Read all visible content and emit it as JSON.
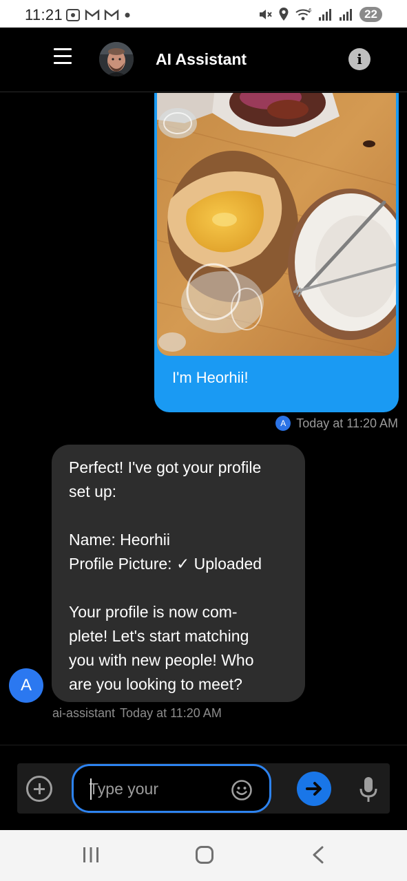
{
  "status_bar": {
    "time": "11:21",
    "battery": "22",
    "left_icons": [
      "screenshot-icon",
      "gmail-icon",
      "gmail-icon",
      "dot-icon"
    ],
    "right_icons": [
      "mute-icon",
      "location-icon",
      "wifi-icon",
      "signal-icon",
      "signal-icon",
      "battery-icon"
    ]
  },
  "header": {
    "title": "AI Assistant",
    "menu_icon": "hamburger-menu-icon",
    "info_icon": "info-icon",
    "info_glyph": "i"
  },
  "messages": {
    "user": {
      "text": "I'm Heorhii!",
      "avatar_letter": "A",
      "timestamp": "Today at 11:20 AM",
      "bubble_color": "#1a9af3"
    },
    "assistant": {
      "lines_1": [
        "Perfect! I've got your profile",
        "set up:"
      ],
      "lines_2": [
        "Name: Heorhii",
        "Profile Picture: ✓ Uploaded"
      ],
      "lines_3": [
        "Your profile is now com-",
        "plete! Let's start matching",
        "you with new people! Who",
        "are you looking to meet?"
      ],
      "sender": "ai-assistant",
      "timestamp": "Today at 11:20 AM",
      "avatar_letter": "A",
      "bubble_color": "#2d2d2d"
    }
  },
  "composer": {
    "placeholder": "Type your",
    "accent": "#2d83f0",
    "send_color": "#1976e8"
  },
  "nav_bar": {
    "icons": [
      "recent-apps-icon",
      "home-icon",
      "back-icon"
    ]
  }
}
